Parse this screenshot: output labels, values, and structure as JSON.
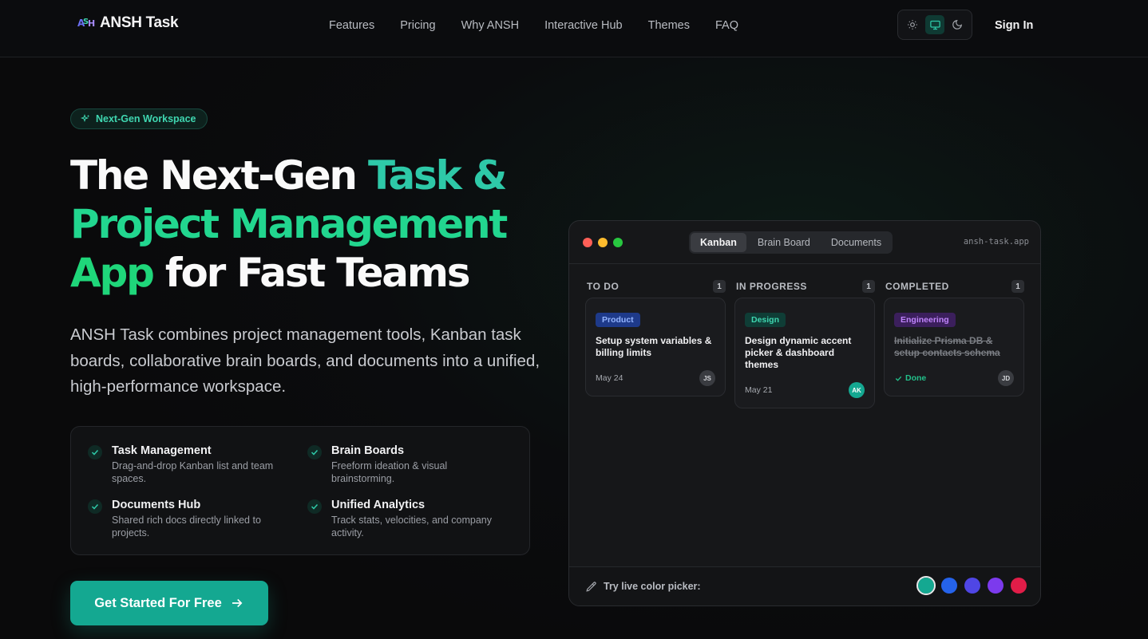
{
  "nav": {
    "logo_text": "ANSH Task",
    "links": [
      "Features",
      "Pricing",
      "Why ANSH",
      "Interactive Hub",
      "Themes",
      "FAQ"
    ],
    "theme_icons": [
      "sun-icon",
      "monitor-icon",
      "moon-icon"
    ],
    "theme_active": "system",
    "sign_in": "Sign In"
  },
  "hero": {
    "badge": "Next-Gen Workspace",
    "headline": {
      "part1": "The Next-Gen ",
      "part2": "Task &",
      "part3": "Project Management",
      "part4": "App",
      "part5": " for Fast Teams"
    },
    "lead": "ANSH Task combines project management tools, Kanban task boards, collaborative brain boards, and documents into a unified, high-performance workspace.",
    "features": [
      {
        "title": "Task Management",
        "desc": "Drag-and-drop Kanban list and team spaces."
      },
      {
        "title": "Brain Boards",
        "desc": "Freeform ideation & visual brainstorming."
      },
      {
        "title": "Documents Hub",
        "desc": "Shared rich docs directly linked to projects."
      },
      {
        "title": "Unified Analytics",
        "desc": "Track stats, velocities, and company activity."
      }
    ],
    "cta": "Get Started For Free"
  },
  "preview": {
    "tabs": [
      "Kanban",
      "Brain Board",
      "Documents"
    ],
    "active_tab": "Kanban",
    "url": "ansh-task.app",
    "columns": [
      {
        "title": "TO DO",
        "count": "1",
        "card": {
          "tag": "Product",
          "title": "Setup system variables & billing limits",
          "date": "May 24",
          "avatar": "JS",
          "done": false
        }
      },
      {
        "title": "IN PROGRESS",
        "count": "1",
        "card": {
          "tag": "Design",
          "title": "Design dynamic accent picker & dashboard themes",
          "date": "May 21",
          "avatar": "AK",
          "done": false
        }
      },
      {
        "title": "COMPLETED",
        "count": "1",
        "card": {
          "tag": "Engineering",
          "title": "Initialize Prisma DB & setup contacts schema",
          "status": "Done",
          "avatar": "JD",
          "done": true
        }
      }
    ],
    "picker_label": "Try live color picker:",
    "swatch_colors": [
      "#14a891",
      "#2563eb",
      "#4f46e5",
      "#7c3aed",
      "#e11d48"
    ]
  },
  "colors": {
    "accent": "#14a891",
    "accent_bright": "#2ec9a8",
    "background": "#0b0c0e",
    "tag_product": "#1e3a8a",
    "tag_design": "#0f3d36",
    "tag_engineering": "#3b1f5c"
  }
}
